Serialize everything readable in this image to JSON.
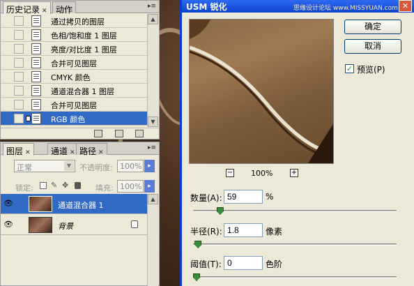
{
  "history_panel": {
    "tabs": [
      "历史记录",
      "动作"
    ],
    "items": [
      {
        "label": "通过拷贝的图层",
        "selected": false
      },
      {
        "label": "色相/饱和度 1 图层",
        "selected": false
      },
      {
        "label": "亮度/对比度 1 图层",
        "selected": false
      },
      {
        "label": "合并可见图层",
        "selected": false
      },
      {
        "label": "CMYK 颜色",
        "selected": false
      },
      {
        "label": "通道混合器 1 图层",
        "selected": false
      },
      {
        "label": "合并可见图层",
        "selected": false
      },
      {
        "label": "RGB 颜色",
        "selected": true
      }
    ]
  },
  "layers_panel": {
    "tabs": [
      "图层",
      "通道",
      "路径"
    ],
    "blend_mode": "正常",
    "opacity_label": "不透明度:",
    "opacity_value": "100%",
    "lock_label": "锁定:",
    "fill_label": "填充:",
    "fill_value": "100%",
    "layers": [
      {
        "name": "通道混合器 1",
        "selected": true,
        "locked": false
      },
      {
        "name": "背景",
        "selected": false,
        "locked": true
      }
    ]
  },
  "usm_dialog": {
    "title": "USM 锐化",
    "watermark": "思缘设计论坛 www.MISSYUAN.com",
    "ok_label": "确定",
    "cancel_label": "取消",
    "preview_label": "预览(P)",
    "preview_checked": true,
    "zoom": "100%",
    "amount_label": "数量(A):",
    "amount_value": "59",
    "amount_unit": "%",
    "radius_label": "半径(R):",
    "radius_value": "1.8",
    "radius_unit": "像素",
    "threshold_label": "阈值(T):",
    "threshold_value": "0",
    "threshold_unit": "色阶",
    "amount_slider_fraction": 0.12,
    "radius_slider_fraction": 0.008,
    "threshold_slider_fraction": 0.0
  },
  "colors": {
    "selection_blue": "#316ac5",
    "title_blue": "#0d44d0",
    "slider_green": "#3c8a3c"
  },
  "icons": [
    "document-icon",
    "eye-icon",
    "lock-icon",
    "close-icon",
    "zoom-in-icon",
    "zoom-out-icon",
    "trash-icon",
    "new-document-icon",
    "snapshot-icon"
  ]
}
